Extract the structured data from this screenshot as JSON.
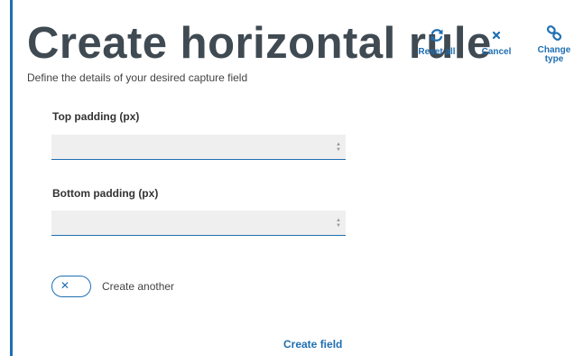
{
  "header": {
    "title": "Create horizontal rule",
    "subtitle": "Define the details of your desired capture field"
  },
  "actions": {
    "reset_label": "Reset all",
    "cancel_label": "Cancel",
    "change_label": "Change type"
  },
  "form": {
    "top_padding": {
      "label": "Top padding (px)",
      "value": ""
    },
    "bottom_padding": {
      "label": "Bottom padding (px)",
      "value": ""
    },
    "create_another": {
      "label": "Create another",
      "enabled": false
    }
  },
  "footer": {
    "create_label": "Create field"
  },
  "icons": {
    "reset": "refresh-icon",
    "cancel": "close-icon",
    "change": "link-icon",
    "toggle": "close-icon"
  },
  "colors": {
    "accent": "#1f6fb2",
    "title": "#3f4a52",
    "input_bg": "#efefef"
  }
}
